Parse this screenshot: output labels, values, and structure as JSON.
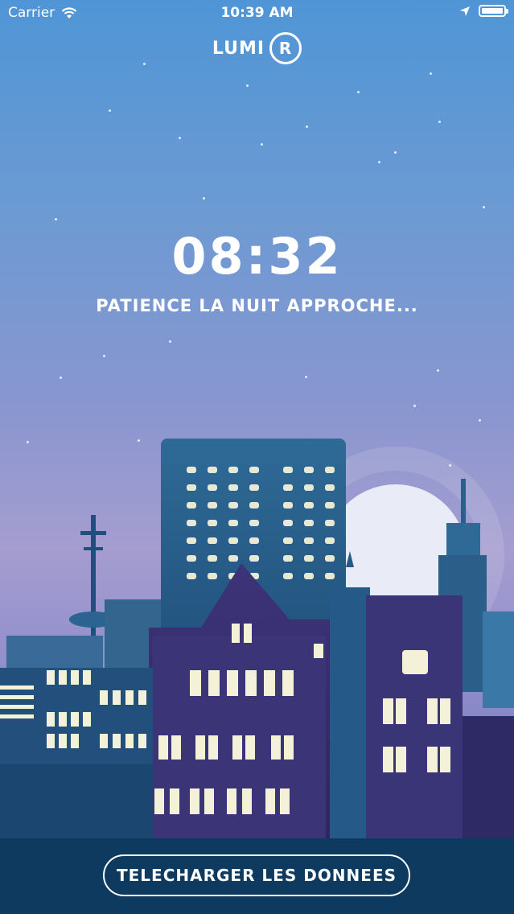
{
  "status_bar": {
    "carrier": "Carrier",
    "time": "10:39 AM",
    "wifi_icon": "wifi-icon",
    "location_icon": "location-arrow-icon",
    "battery_icon": "battery-icon",
    "battery_level": 1.0
  },
  "logo": {
    "text": "LUMI",
    "ring_letter": "R"
  },
  "countdown": {
    "time": "08:32",
    "message": "PATIENCE LA NUIT APPROCHE..."
  },
  "actions": {
    "download_label": "TELECHARGER LES DONNEES"
  },
  "colors": {
    "sky_top": "#4f95d6",
    "sky_bottom": "#8f8ccb",
    "bottom_bar": "#0f3a60",
    "window_light": "#fff6cc"
  }
}
